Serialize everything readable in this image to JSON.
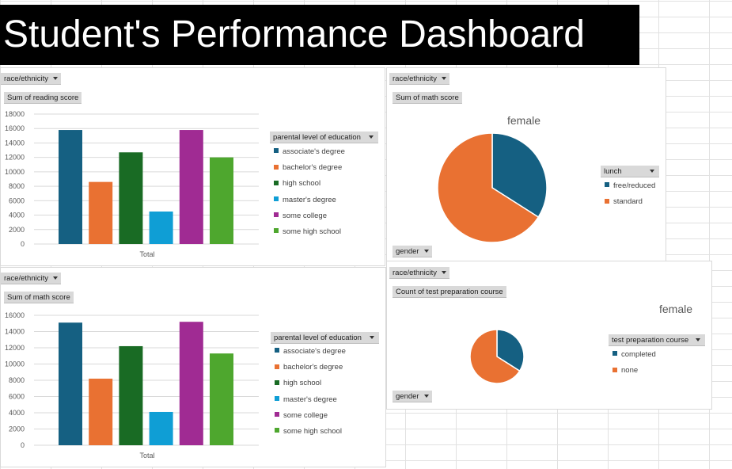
{
  "title": "Student's Performance Dashboard",
  "colors": {
    "associate": "#156082",
    "bachelor": "#E97132",
    "highschool": "#196B24",
    "masters": "#0F9ED5",
    "somecollege": "#A02B93",
    "somehigh": "#4EA72E"
  },
  "chart_data": [
    {
      "type": "bar",
      "filter": "race/ethnicity",
      "value_field": "Sum of reading score",
      "categories": [
        "Total"
      ],
      "series": [
        {
          "name": "associate's degree",
          "values": [
            15800
          ]
        },
        {
          "name": "bachelor's degree",
          "values": [
            8600
          ]
        },
        {
          "name": "high school",
          "values": [
            12700
          ]
        },
        {
          "name": "master's degree",
          "values": [
            4500
          ]
        },
        {
          "name": "some college",
          "values": [
            15800
          ]
        },
        {
          "name": "some high school",
          "values": [
            12000
          ]
        }
      ],
      "ylim": [
        0,
        18000
      ],
      "yticks": [
        "0",
        "2000",
        "4000",
        "6000",
        "8000",
        "10000",
        "12000",
        "14000",
        "16000",
        "18000"
      ],
      "legend_title": "parental level of education",
      "grid": true
    },
    {
      "type": "bar",
      "filter": "race/ethnicity",
      "value_field": "Sum of math score",
      "categories": [
        "Total"
      ],
      "series": [
        {
          "name": "associate's degree",
          "values": [
            15100
          ]
        },
        {
          "name": "bachelor's degree",
          "values": [
            8200
          ]
        },
        {
          "name": "high school",
          "values": [
            12200
          ]
        },
        {
          "name": "master's degree",
          "values": [
            4100
          ]
        },
        {
          "name": "some college",
          "values": [
            15200
          ]
        },
        {
          "name": "some high school",
          "values": [
            11300
          ]
        }
      ],
      "ylim": [
        0,
        16000
      ],
      "yticks": [
        "0",
        "2000",
        "4000",
        "6000",
        "8000",
        "10000",
        "12000",
        "14000",
        "16000"
      ],
      "legend_title": "parental level of education",
      "grid": true
    },
    {
      "type": "pie",
      "filter": "race/ethnicity",
      "value_field": "Sum of math score",
      "title": "female",
      "axis_field": "gender",
      "legend_title": "lunch",
      "slices": [
        {
          "name": "free/reduced",
          "value": 34
        },
        {
          "name": "standard",
          "value": 66
        }
      ]
    },
    {
      "type": "pie",
      "filter": "race/ethnicity",
      "value_field": "Count of test preparation course",
      "title": "female",
      "axis_field": "gender",
      "legend_title": "test preparation course",
      "slices": [
        {
          "name": "completed",
          "value": 34
        },
        {
          "name": "none",
          "value": 66
        }
      ]
    }
  ]
}
